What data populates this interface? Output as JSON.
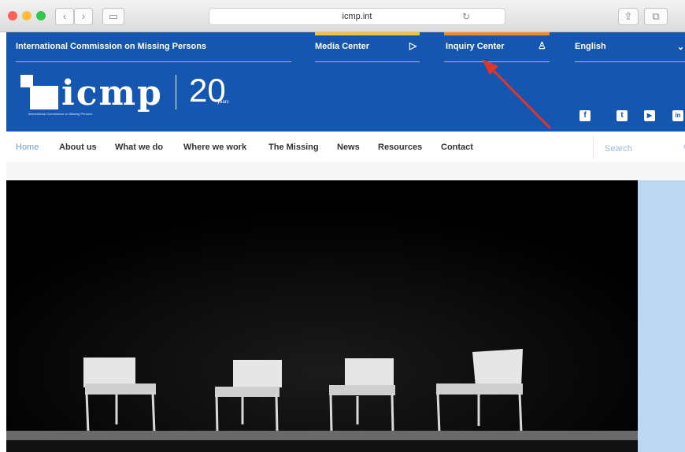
{
  "browser": {
    "url": "icmp.int",
    "traffic_lights": [
      "#fc605b",
      "#fdbc40",
      "#34c84a"
    ]
  },
  "topbar": {
    "org_name": "International Commission on Missing Persons",
    "media_center": "Media Center",
    "inquiry_center": "Inquiry Center",
    "language": "English",
    "accent_colors": [
      "#e9c63a",
      "#f08c2b"
    ]
  },
  "logo": {
    "text": "icmp",
    "subtitle": "International Commission on Missing Persons",
    "anniversary": "20",
    "anniversary_sub": "years"
  },
  "social": {
    "facebook": "f",
    "twitter": "t",
    "youtube": "▶",
    "linkedin": "in"
  },
  "mainnav": {
    "items": [
      "Home",
      "About us",
      "What we do",
      "Where we work",
      "The Missing",
      "News",
      "Resources",
      "Contact"
    ],
    "active": "Home",
    "search_placeholder": "Search"
  },
  "colors": {
    "brand_blue": "#1557b0",
    "annotation_red": "#e0362a",
    "side_panel": "#bdd9f1"
  }
}
